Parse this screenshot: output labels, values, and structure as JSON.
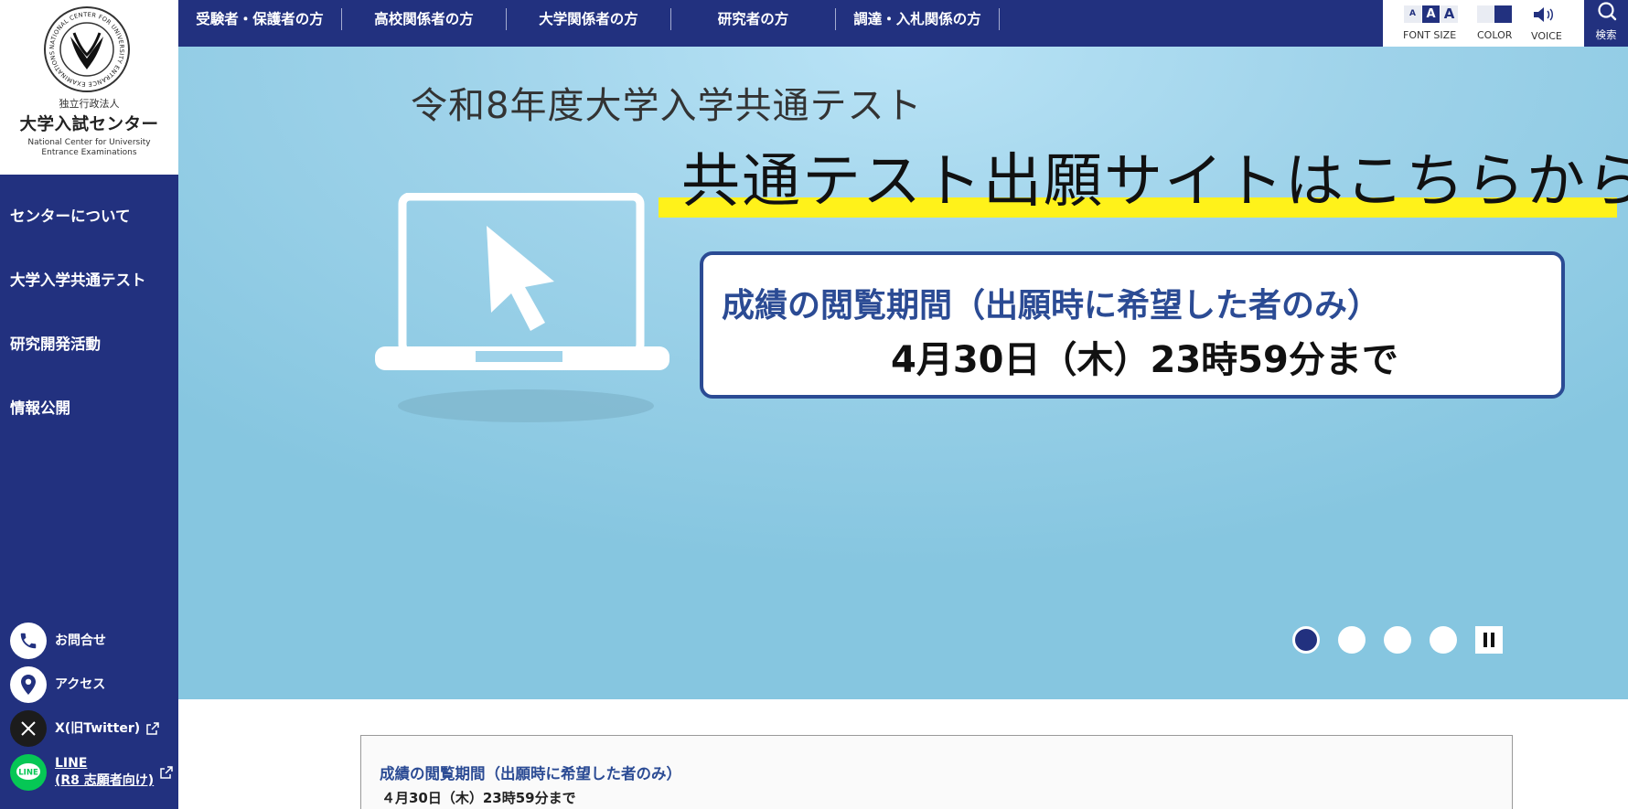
{
  "logo": {
    "emblem_text": "NATIONAL CENTER FOR UNIVERSITY ENTRANCE EXAMINATIONS",
    "subtitle": "独立行政法人",
    "name": "大学入試センター",
    "english": "National Center for University Entrance Examinations"
  },
  "sidebar": {
    "nav": [
      {
        "label": "センターについて"
      },
      {
        "label": "大学入学共通テスト"
      },
      {
        "label": "研究開発活動"
      },
      {
        "label": "情報公開"
      }
    ],
    "links": [
      {
        "label": "お問合せ",
        "icon": "phone-icon"
      },
      {
        "label": "アクセス",
        "icon": "map-pin-icon"
      },
      {
        "label": "X(旧Twitter)",
        "icon": "x-logo-icon"
      },
      {
        "label_line1": "LINE",
        "label_line2": "(R8 志願者向け)",
        "icon": "line-logo-icon"
      }
    ]
  },
  "topnav": [
    {
      "label": "受験者・保護者の方"
    },
    {
      "label": "高校関係者の方"
    },
    {
      "label": "大学関係者の方"
    },
    {
      "label": "研究者の方"
    },
    {
      "label": "調達・入札関係の方"
    }
  ],
  "tools": {
    "font_size_label": "FONT SIZE",
    "font_sizes": [
      "A",
      "A",
      "A"
    ],
    "color_label": "COLOR",
    "voice_label": "VOICE",
    "search_label": "検索"
  },
  "hero": {
    "year_text": "令和8年度大学入学共通テスト",
    "title": "共通テスト出願サイトはこちらから",
    "info_line1": "成績の閲覧期間（出願時に希望した者のみ）",
    "info_line2": "4月30日（木）23時59分まで",
    "slides_total": 4,
    "active_slide": 1
  },
  "notice": {
    "title": "成績の閲覧期間（出願時に希望した者のみ）",
    "body": "４月30日（木）23時59分まで"
  },
  "colors": {
    "navy": "#22317f",
    "info_blue": "#2b4b94",
    "highlight_yellow": "#fff21a",
    "hero_blue": "#9fd3ea",
    "line_green": "#06c755"
  }
}
